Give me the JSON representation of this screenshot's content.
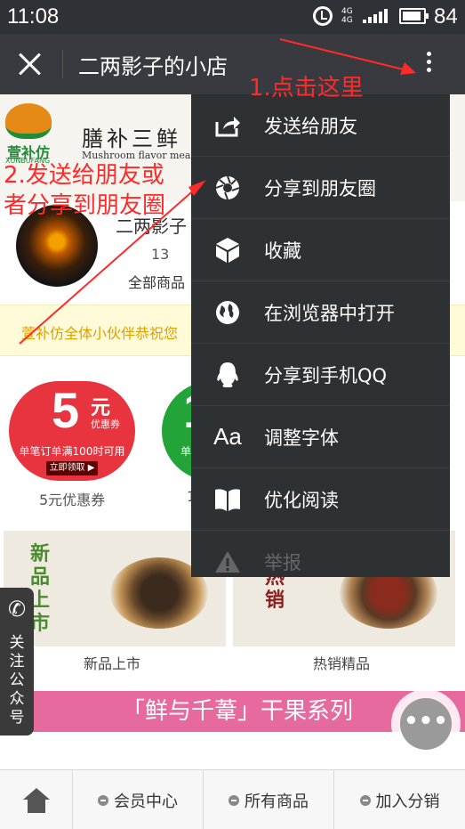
{
  "status_bar": {
    "time": "11:08",
    "network": "4G 4G",
    "battery": "84"
  },
  "title_bar": {
    "title": "二两影子的小店"
  },
  "banner": {
    "logo_text": "萱补仿",
    "logo_sub": "XUNBUFANG",
    "brand": "膳补三鲜",
    "brand_sub": "Mushroom flavor meal s"
  },
  "shop": {
    "name": "二两影子",
    "count": "13",
    "count_label": "全部商品"
  },
  "notice": {
    "text": "萱补仿全体小伙伴恭祝您"
  },
  "coupons": [
    {
      "amount": "5",
      "unit": "元",
      "type": "优惠券",
      "rule": "单笔订单满100时可用",
      "action": "立即领取 ▶",
      "label": "5元优惠券"
    },
    {
      "amount": "1",
      "unit": "",
      "type": "",
      "rule": "单",
      "action": "",
      "label": "1"
    }
  ],
  "tiles": [
    {
      "vertical_text": "新品上市",
      "label": "新品上市"
    },
    {
      "vertical_text": "牌热销",
      "label": "热销精品"
    }
  ],
  "series_banner": "「鲜与千葦」干果系列",
  "follow_widget": {
    "text": "关注公众号"
  },
  "bottom_nav": {
    "items": [
      "会员中心",
      "所有商品",
      "加入分销"
    ]
  },
  "menu": {
    "items": [
      {
        "label": "发送给朋友",
        "icon": "share-icon"
      },
      {
        "label": "分享到朋友圈",
        "icon": "moments-icon"
      },
      {
        "label": "收藏",
        "icon": "favorite-cube-icon"
      },
      {
        "label": "在浏览器中打开",
        "icon": "globe-icon"
      },
      {
        "label": "分享到手机QQ",
        "icon": "qq-icon"
      },
      {
        "label": "调整字体",
        "icon": "font-icon"
      },
      {
        "label": "优化阅读",
        "icon": "book-icon"
      },
      {
        "label": "举报",
        "icon": "warning-icon"
      }
    ]
  },
  "annotations": {
    "step1": "1.点击这里",
    "step2_line1": "2.发送给朋友或",
    "step2_line2": "者分享到朋友圈"
  },
  "colors": {
    "annotation": "#ff2a2a",
    "menu_bg": "#2e3134",
    "titlebar_bg": "#393a3f",
    "coupon_red": "#e7343e",
    "series_pink": "#e76a9e"
  }
}
